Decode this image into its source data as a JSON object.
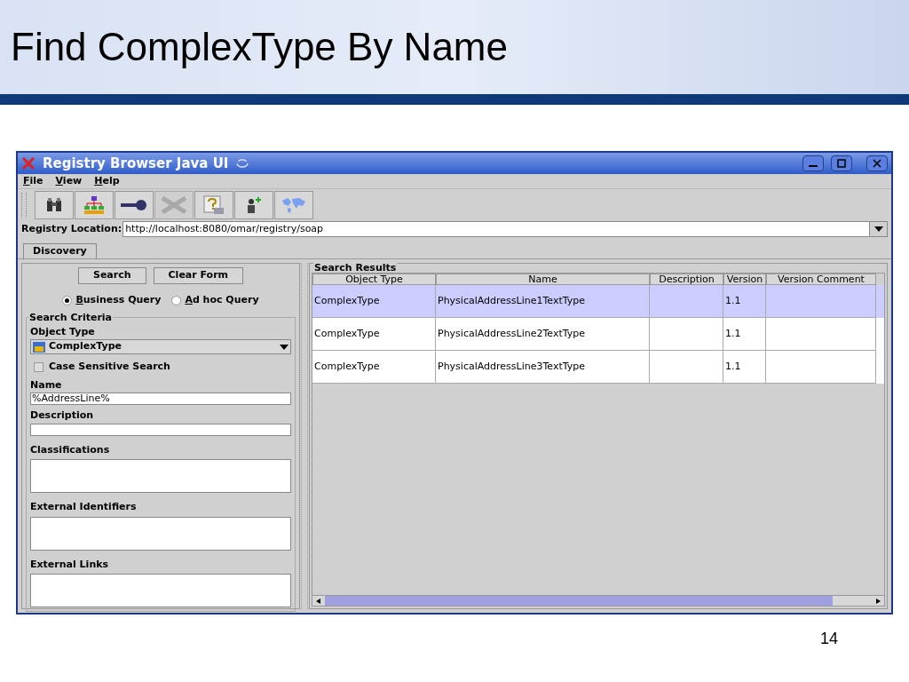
{
  "slide": {
    "title": "Find ComplexType By Name",
    "page_number": "14"
  },
  "window": {
    "title": "Registry Browser Java UI"
  },
  "menu": [
    "File",
    "View",
    "Help"
  ],
  "toolbar": [
    {
      "kind": "binoculars",
      "disabled": false
    },
    {
      "kind": "hierarchy",
      "disabled": false
    },
    {
      "kind": "key",
      "disabled": false
    },
    {
      "kind": "cross",
      "disabled": true
    },
    {
      "kind": "help",
      "disabled": false
    },
    {
      "kind": "user",
      "disabled": false
    },
    {
      "kind": "map",
      "disabled": false
    }
  ],
  "registry_location": {
    "label": "Registry Location:",
    "value": "http://localhost:8080/omar/registry/soap"
  },
  "tabs": [
    {
      "label": "Discovery",
      "selected": true
    }
  ],
  "form_buttons": [
    "Search",
    "Clear Form"
  ],
  "query_types": [
    {
      "label": "Business Query",
      "selected": true
    },
    {
      "label": "Ad hoc Query",
      "selected": false
    }
  ],
  "search_criteria": {
    "title": "Search Criteria",
    "object_type_label": "Object Type",
    "object_type": "ComplexType",
    "case_sensitive": {
      "label": "Case Sensitive Search",
      "checked": false
    },
    "fields": [
      {
        "label": "Name",
        "kind": "line",
        "value": "%AddressLine%"
      },
      {
        "label": "Description",
        "kind": "line"
      },
      {
        "label": "Classifications",
        "kind": "box"
      },
      {
        "label": "External Identifiers",
        "kind": "box"
      },
      {
        "label": "External Links",
        "kind": "box"
      }
    ]
  },
  "results": {
    "title": "Search Results",
    "columns": [
      "Object Type",
      "Name",
      "Description",
      "Version",
      "Version Comment"
    ],
    "rows": [
      {
        "cells": [
          "ComplexType",
          "PhysicalAddressLine1TextType",
          "",
          "1.1",
          ""
        ],
        "selected": true
      },
      {
        "cells": [
          "ComplexType",
          "PhysicalAddressLine2TextType",
          "",
          "1.1",
          ""
        ],
        "selected": false
      },
      {
        "cells": [
          "ComplexType",
          "PhysicalAddressLine3TextType",
          "",
          "1.1",
          ""
        ],
        "selected": false
      }
    ]
  }
}
